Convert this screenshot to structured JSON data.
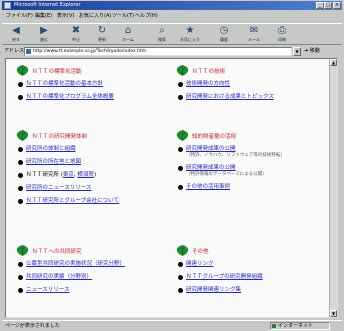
{
  "window": {
    "title": "Microsoft Internet Explorer"
  },
  "menu": [
    "ファイル(F)",
    "編集(E)",
    "表示(V)",
    "お気に入り(A)",
    "ツール(T)",
    "ヘルプ(H)"
  ],
  "toolbar": [
    {
      "icon": "back-icon",
      "glyph": "◀",
      "label": "戻る"
    },
    {
      "icon": "forward-icon",
      "glyph": "▶",
      "label": "進む"
    },
    {
      "icon": "stop-icon",
      "glyph": "✖",
      "label": "中止"
    },
    {
      "icon": "refresh-icon",
      "glyph": "↻",
      "label": "更新"
    },
    {
      "icon": "home-icon",
      "glyph": "⌂",
      "label": "ホーム"
    },
    {
      "icon": "search-icon",
      "glyph": "⌕",
      "label": "検索"
    },
    {
      "icon": "favorites-icon",
      "glyph": "★",
      "label": "お気に入り"
    },
    {
      "icon": "history-icon",
      "glyph": "◷",
      "label": "履歴"
    },
    {
      "icon": "mail-icon",
      "glyph": "✉",
      "label": "メール"
    },
    {
      "icon": "print-icon",
      "glyph": "⎙",
      "label": "印刷"
    }
  ],
  "address": {
    "label": "アドレス(D)",
    "url": "http://www.tt.example.co.jp/Tech/kyodo/index.htm",
    "go": "移動"
  },
  "sections": [
    {
      "title": "ＮＴＴの標準化活動",
      "items": [
        {
          "text": "ＮＴＴの標準化活動の基本方針",
          "link": true
        },
        {
          "text": "ＮＴＴの標準化プログラム全体概要",
          "link": true
        }
      ]
    },
    {
      "title": "ＮＴＴの技術",
      "items": [
        {
          "text": "技術開発の方向性",
          "link": true
        },
        {
          "text": "研究開発における成果とトピックス",
          "link": true
        }
      ]
    },
    {
      "title": "ＮＴＴの研究開発体制",
      "items": [
        {
          "text": "研究所の体制と組織",
          "link": true
        },
        {
          "text": "研究所の所在地と地図",
          "link": true
        },
        {
          "text": "ＮＴＴ研究所 (",
          "link": false,
          "inline": [
            "東京",
            "横須賀"
          ],
          "suffix": ")"
        },
        {
          "text": "研究所のニュースリリース",
          "link": true
        },
        {
          "text": "ＮＴＴ研究所とグループ会社について",
          "link": true
        }
      ]
    },
    {
      "title": "知的財産権の活用",
      "items": [
        {
          "text": "研究開発成果の公開",
          "link": true,
          "sub": "（特許、ノウハウ、ソフトウェア等の技術移転）"
        },
        {
          "text": "研究開発成果の公開",
          "link": true,
          "sub": "（特許情報のデータベースによる公開）"
        },
        {
          "text": "その他の活用事例",
          "link": true
        }
      ]
    },
    {
      "title": "ＮＴＴへの共同研究",
      "items": [
        {
          "text": "公募型共同研究の実施状況（研究分野）",
          "link": true
        },
        {
          "text": "共同研究の実績（分野別）",
          "link": true
        },
        {
          "text": "ニュースリリース",
          "link": true
        }
      ]
    },
    {
      "title": "その他",
      "items": [
        {
          "text": "関連リンク",
          "link": true
        },
        {
          "text": "ＮＴＴグループの研究開発組織",
          "link": true
        },
        {
          "text": "研究開発関連リンク集",
          "link": true
        }
      ]
    }
  ],
  "status": {
    "text": "ページが表示されました",
    "zone": "インターネット"
  },
  "colors": {
    "accent": "#c81e28",
    "link": "#2a2ab8",
    "leaf": "#1f8a2e"
  }
}
